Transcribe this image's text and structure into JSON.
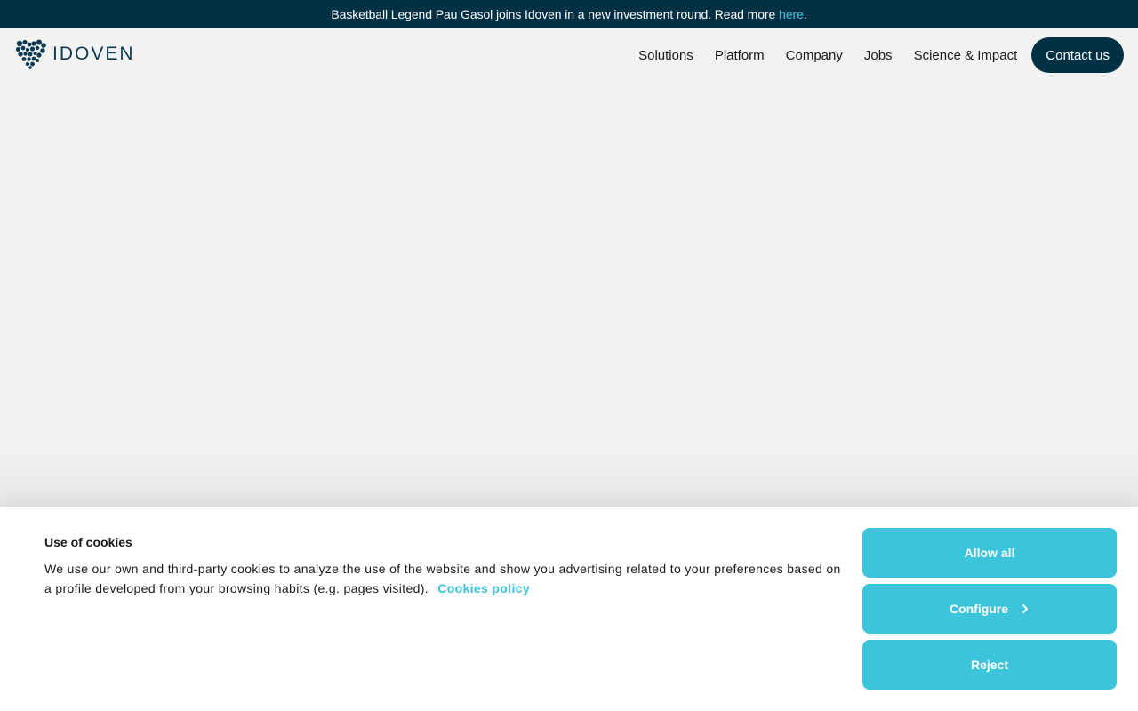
{
  "announcement": {
    "text": "Basketball Legend Pau Gasol joins Idoven in a new investment round. Read more",
    "link_label": "here",
    "suffix": "."
  },
  "header": {
    "logo_text": "IDOVEN",
    "logo_icon": "heart-dots-icon",
    "nav": [
      "Solutions",
      "Platform",
      "Company",
      "Jobs",
      "Science & Impact"
    ],
    "contact_label": "Contact us"
  },
  "cookie_banner": {
    "title": "Use of cookies",
    "text": "We use our own and third-party cookies to analyze the use of the website and show you advertising related to your preferences based on a profile developed from your browsing habits (e.g. pages visited).",
    "policy_label": "Cookies policy",
    "buttons": {
      "allow": "Allow all",
      "configure": "Configure",
      "reject": "Reject"
    }
  },
  "colors": {
    "brand_dark": "#023044",
    "accent": "#3bc4da",
    "link": "#4cc3e0",
    "page_bg": "#f2f2f2"
  }
}
